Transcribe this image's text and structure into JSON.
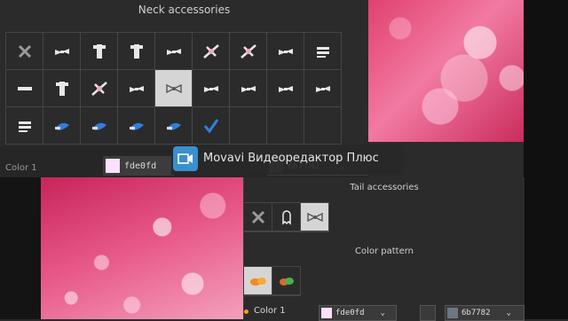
{
  "neck": {
    "title": "Neck accessories",
    "cells": [
      "close-icon",
      "small-bow-icon",
      "tall-bow-icon",
      "feather-icon",
      "small-bow-icon",
      "sparkle-bow-icon",
      "flower-icon",
      "small-bow-icon",
      "striped-bow-icon",
      "dash-icon",
      "ribbon-icon",
      "knot-icon",
      "charm-icon",
      "bow-selected-icon",
      "small-charm-icon",
      "bow-icon",
      "bow-icon",
      "bow-icon",
      "gem-icon",
      "blue-feather-icon",
      "blue-ribbon-icon",
      "blue-bow-icon",
      "blue-swoosh-icon",
      "blue-check-icon",
      "empty",
      "empty",
      "empty"
    ],
    "selected_index": 13
  },
  "color1": {
    "label": "Color 1",
    "hex1": "fde0fd",
    "hex2": "6b7782",
    "swatch1": "#fde0fd",
    "swatch2": "#6b7782"
  },
  "banner": {
    "text": "Movavi Видеоредактор Плюс",
    "icon": "video-editor-icon"
  },
  "tail": {
    "title": "Tail accessories",
    "items": [
      "close-icon",
      "ghost-icon",
      "bow-selected-icon"
    ],
    "selected_index": 2
  },
  "pattern": {
    "title": "Color pattern",
    "items": [
      "orange-pattern-icon",
      "green-pattern-icon"
    ],
    "selected_index": 0
  },
  "bottom_color": {
    "label": "Color 1",
    "hex1": "fde0fd",
    "hex2": "6b7782",
    "swatch1": "#fde0fd",
    "swatch2": "#6b7782"
  }
}
